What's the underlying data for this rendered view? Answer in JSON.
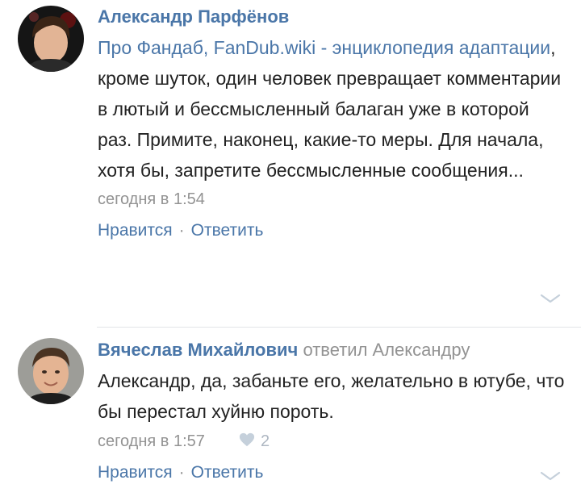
{
  "comments": [
    {
      "author": "Александр Парфёнов",
      "link_text": "Про Фандаб, FanDub.wiki - энциклопедия адаптации",
      "text": ", кроме шуток, один человек превращает комментарии в лютый и бессмысленный балаган уже в которой раз. Примите, наконец, какие-то меры. Для начала, хотя бы, запретите бессмысленные сообщения...",
      "time": "сегодня в 1:54",
      "like_label": "Нравится",
      "reply_label": "Ответить",
      "separator": "·"
    },
    {
      "author": "Вячеслав Михайлович",
      "reply_to": "ответил Александру",
      "text": "Александр, да, забаньте его, желательно в ютубе, что бы перестал хуйню пороть.",
      "time": "сегодня в 1:57",
      "likes_count": "2",
      "like_label": "Нравится",
      "reply_label": "Ответить",
      "separator": "·"
    }
  ],
  "colors": {
    "accent": "#4a76a8",
    "muted": "#939393",
    "text": "#222222"
  },
  "icons": [
    "avatar",
    "heart-icon",
    "chevron-down-icon"
  ]
}
